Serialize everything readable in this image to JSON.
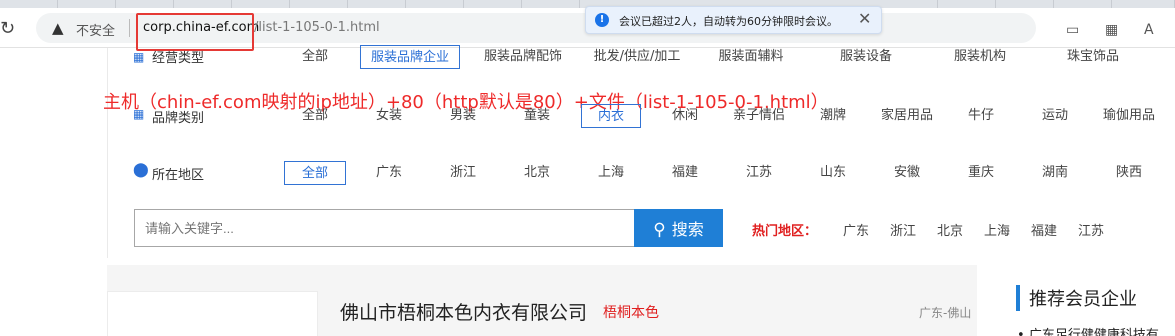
{
  "browser": {
    "insecure_label": "不安全",
    "url_domain": "corp.china-ef.com",
    "url_path": "/list-1-105-0-1.html",
    "notification": "会议已超过2人，自动转为60分钟限时会议。"
  },
  "annotation": "主机（chin-ef.com映射的ip地址）+80（http默认是80）+文件（list-1-105-0-1.html）",
  "filters": {
    "business_type": {
      "label": "经营类型",
      "options": [
        "全部",
        "服装品牌企业",
        "服装品牌配饰",
        "批发/供应/加工",
        "服装面辅料",
        "服装设备",
        "服装机构",
        "珠宝饰品"
      ],
      "selected": "服装品牌企业"
    },
    "brand_category": {
      "label": "品牌类别",
      "options": [
        "全部",
        "女装",
        "男装",
        "童装",
        "内衣",
        "休闲",
        "亲子情侣",
        "潮牌",
        "家居用品",
        "牛仔",
        "运动",
        "瑜伽用品"
      ],
      "selected": "内衣"
    },
    "region": {
      "label": "所在地区",
      "options": [
        "全部",
        "广东",
        "浙江",
        "北京",
        "上海",
        "福建",
        "江苏",
        "山东",
        "安徽",
        "重庆",
        "湖南",
        "陕西"
      ],
      "selected": "全部"
    }
  },
  "search": {
    "placeholder": "请输入关键字...",
    "button_label": "搜索",
    "hot_label": "热门地区：",
    "hot_regions": [
      "广东",
      "浙江",
      "北京",
      "上海",
      "福建",
      "江苏"
    ]
  },
  "company": {
    "name": "佛山市梧桐本色内衣有限公司",
    "brand": "梧桐本色",
    "region": "广东-佛山"
  },
  "sidebar": {
    "title": "推荐会员企业",
    "first_item": "广东足行健健康科技有"
  },
  "colors": {
    "accent": "#1f7fd6",
    "highlight_red": "#e53935",
    "hot_red": "#e02020"
  }
}
